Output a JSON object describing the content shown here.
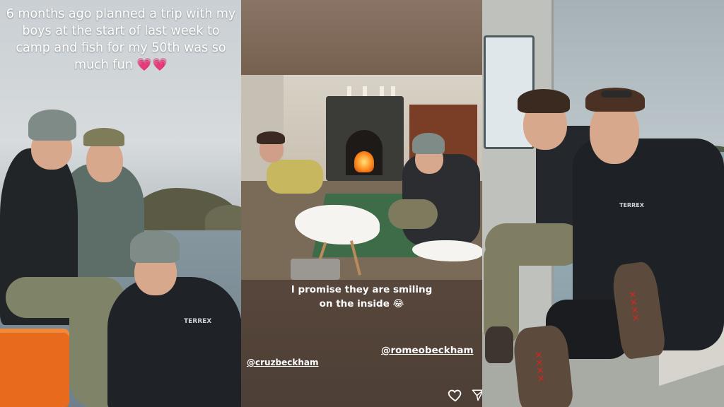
{
  "panels": [
    {
      "id": "panel-1",
      "caption": "6 months ago planned a trip with my boys at the start of last week to camp and fish for my 50th was so much fun",
      "emoji": "💗💗",
      "jacket_brand": "TERREX"
    },
    {
      "id": "panel-2",
      "text_line1": "I promise they are smiling",
      "text_line2": "on the inside 😂",
      "mention_left": "@cruzbeckham",
      "mention_right": "@romeobeckham"
    },
    {
      "id": "panel-3",
      "jacket_brand": "TERREX"
    }
  ],
  "icons": {
    "like": "heart-outline-icon",
    "share": "send-icon"
  },
  "colors": {
    "caption_text": "#ffffff",
    "heart_emoji": "#ff3fa4",
    "crate": "#e76a1d",
    "lace_red": "#c82a22"
  }
}
